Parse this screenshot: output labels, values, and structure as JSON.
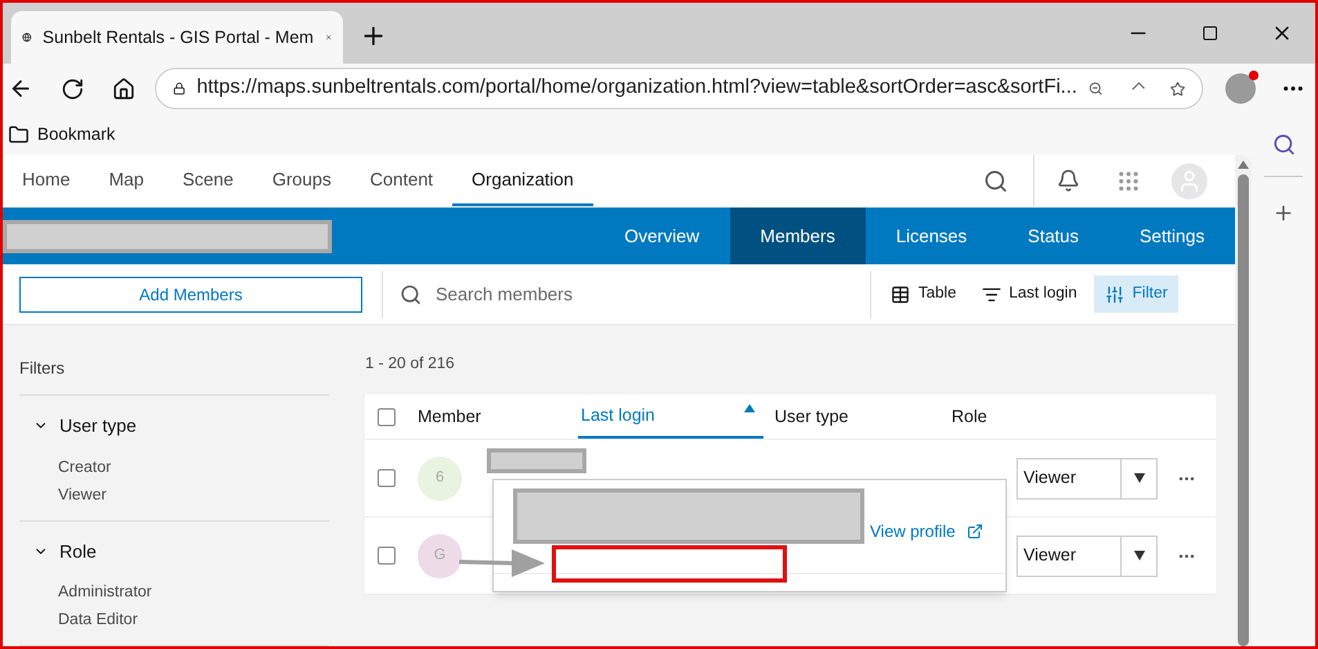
{
  "browser": {
    "tab_title": "Sunbelt Rentals - GIS Portal - Mem",
    "url": "https://maps.sunbeltrentals.com/portal/home/organization.html?view=table&sortOrder=asc&sortFi...",
    "bookmark": "Bookmark"
  },
  "nav": [
    {
      "label": "Home",
      "selected": false
    },
    {
      "label": "Map",
      "selected": false
    },
    {
      "label": "Scene",
      "selected": false
    },
    {
      "label": "Groups",
      "selected": false
    },
    {
      "label": "Content",
      "selected": false
    },
    {
      "label": "Organization",
      "selected": true
    }
  ],
  "org_tabs": [
    {
      "label": "Overview",
      "selected": false
    },
    {
      "label": "Members",
      "selected": true
    },
    {
      "label": "Licenses",
      "selected": false
    },
    {
      "label": "Status",
      "selected": false
    },
    {
      "label": "Settings",
      "selected": false
    }
  ],
  "toolbar": {
    "add_button": "Add Members",
    "search_placeholder": "Search members",
    "view": "Table",
    "sort": "Last login",
    "filter": {
      "label": "Filter",
      "selected": true
    }
  },
  "filters": {
    "title": "Filters",
    "groups": [
      {
        "label": "User type",
        "expanded": true,
        "options": [
          "Creator",
          "Viewer"
        ]
      },
      {
        "label": "Role",
        "expanded": true,
        "options": [
          "Administrator",
          "Data Editor"
        ]
      }
    ]
  },
  "results": "1 - 20 of 216",
  "table": {
    "columns": [
      {
        "label": "Member",
        "sorted": false
      },
      {
        "label": "Last login",
        "sorted": true
      },
      {
        "label": "User type",
        "sorted": false
      },
      {
        "label": "Role",
        "sorted": false
      }
    ],
    "all_checked": false,
    "rows": [
      {
        "initial": "6",
        "color": "#e8f3e0",
        "role": "Viewer",
        "checked": false
      },
      {
        "initial": "G",
        "color": "#eedbe8",
        "role": "Viewer",
        "checked": false
      }
    ]
  },
  "popup": {
    "link": "View profile"
  }
}
